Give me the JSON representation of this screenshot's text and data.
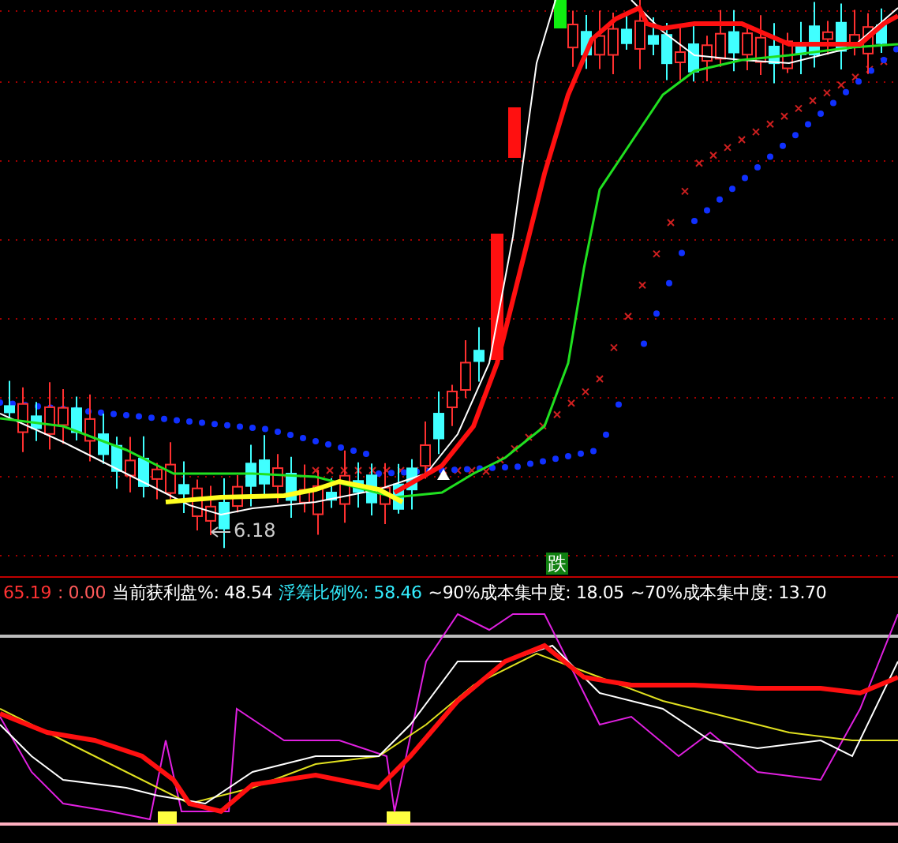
{
  "price_chart": {
    "low_label": "6.18",
    "signal_badge": "跌"
  },
  "info_bar": [
    {
      "text": "65.19",
      "kind": "price"
    },
    {
      "text": ": 0.00",
      "kind": "change"
    },
    {
      "text": "当前获利盘%: 48.54",
      "kind": "plain"
    },
    {
      "text": "浮筹比例%: 58.46",
      "kind": "highlight"
    },
    {
      "text": "~90%成本集中度: 18.05",
      "kind": "plain"
    },
    {
      "text": "~70%成本集中度: 13.70",
      "kind": "plain"
    }
  ]
}
